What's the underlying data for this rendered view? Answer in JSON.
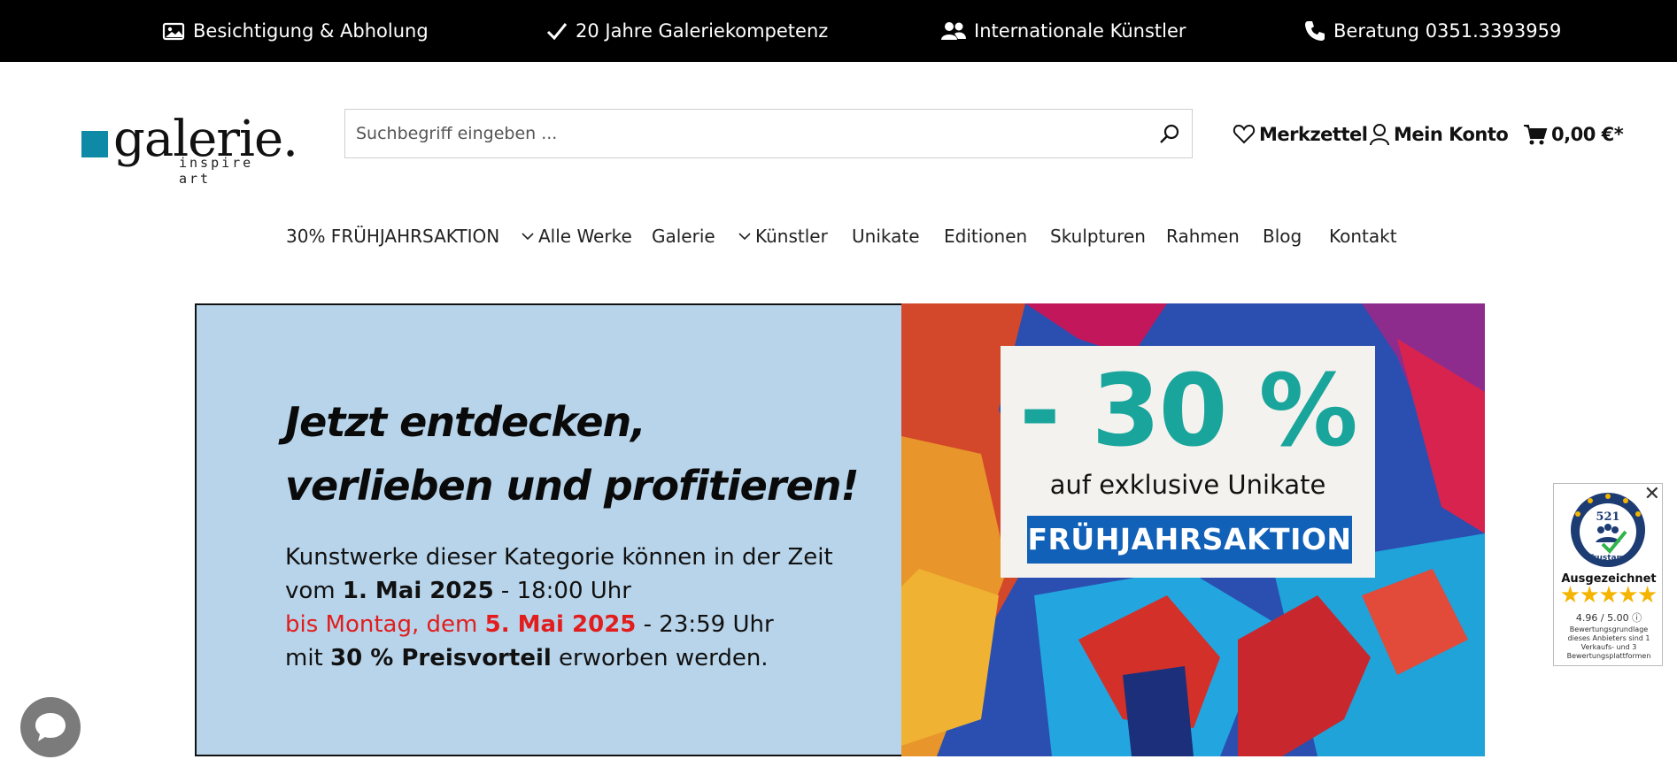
{
  "topbar": {
    "items": [
      {
        "icon": "image-icon",
        "label": "Besichtigung & Abholung"
      },
      {
        "icon": "check-icon",
        "label": "20 Jahre Galeriekompetenz"
      },
      {
        "icon": "users-icon",
        "label": "Internationale Künstler"
      },
      {
        "icon": "phone-icon",
        "label": "Beratung 0351.3393959"
      }
    ]
  },
  "logo": {
    "word": "galerie.",
    "sub": "inspire art",
    "accent": "#0e8aa6"
  },
  "search": {
    "placeholder": "Suchbegriff eingeben ..."
  },
  "header": {
    "wishlist": "Merkzettel",
    "account": "Mein Konto",
    "cart": "0,00 €*"
  },
  "nav": {
    "items": [
      {
        "label": "30% FRÜHJAHRSAKTION",
        "dropdown": false
      },
      {
        "label": "Alle Werke",
        "dropdown": true
      },
      {
        "label": "Galerie",
        "dropdown": false
      },
      {
        "label": "Künstler",
        "dropdown": true
      },
      {
        "label": "Unikate",
        "dropdown": false
      },
      {
        "label": "Editionen",
        "dropdown": false
      },
      {
        "label": "Skulpturen",
        "dropdown": false
      },
      {
        "label": "Rahmen",
        "dropdown": false
      },
      {
        "label": "Blog",
        "dropdown": false
      },
      {
        "label": "Kontakt",
        "dropdown": false
      }
    ]
  },
  "banner": {
    "headline_line1": "Jetzt entdecken,",
    "headline_line2": "verlieben und profitieren!",
    "line1": "Kunstwerke dieser Kategorie können in der Zeit",
    "line2_a": "vom ",
    "line2_b": "1. Mai 2025",
    "line2_c": " - 18:00 Uhr",
    "line3_a": "bis Montag, dem ",
    "line3_b": "5. Mai 2025",
    "line3_c": " - 23:59 Uhr",
    "line4_a": "mit ",
    "line4_b": "30 % Preisvorteil",
    "line4_c": " erworben werden.",
    "promo_percent": "- 30 %",
    "promo_sub": "auf exklusive Unikate",
    "promo_tag": "FRÜHJAHRSAKTION",
    "colors": {
      "left_bg": "#b8d4ea",
      "highlight_red": "#e11d1d",
      "teal": "#19a59b",
      "tag_blue": "#1161b8"
    }
  },
  "trust": {
    "close": "✕",
    "count": "521",
    "brand": "Trustami",
    "title": "Ausgezeichnet",
    "score": "4.96 / 5.00",
    "info_icon": "info-icon",
    "note": "Bewertungsgrundlage dieses Anbieters sind 1 Verkaufs- und 3 Bewertungsplattformen",
    "stars": 5
  },
  "chat": {
    "icon": "chat-bubble-icon"
  }
}
